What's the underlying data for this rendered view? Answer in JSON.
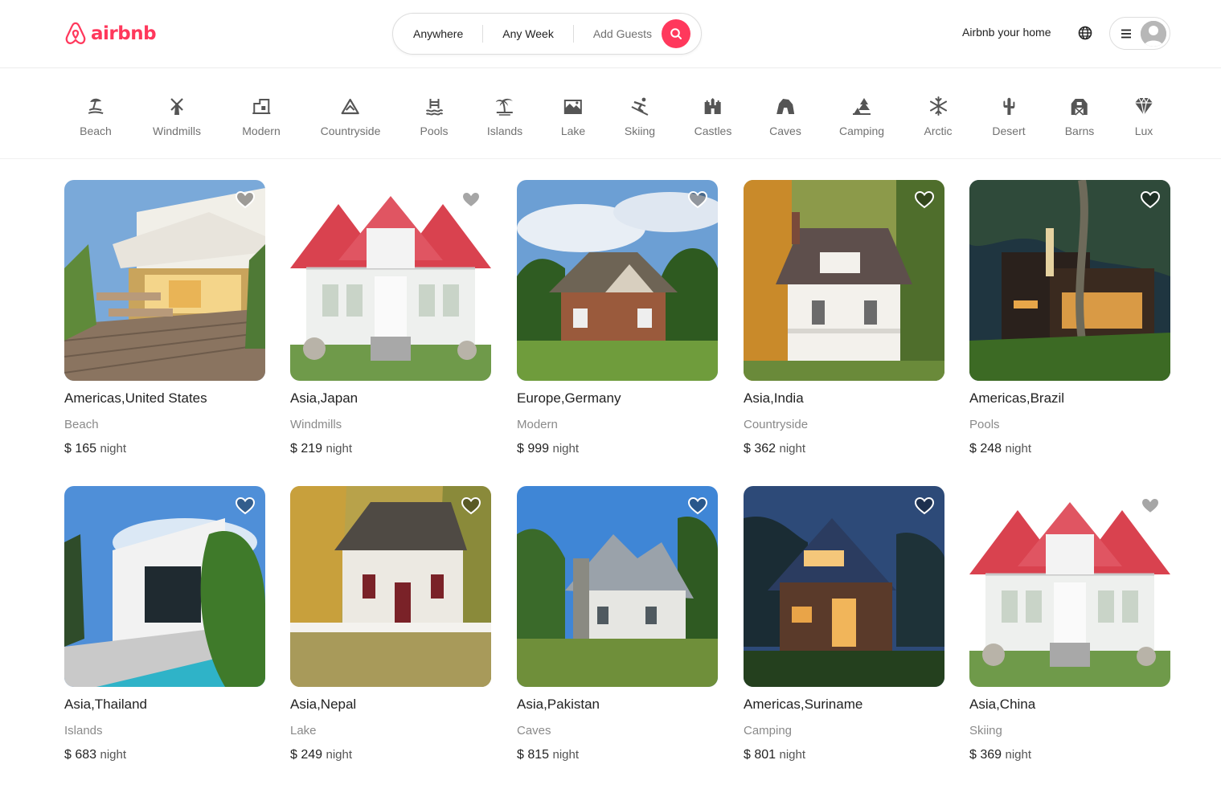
{
  "header": {
    "logo_text": "airbnb",
    "search": {
      "anywhere": "Anywhere",
      "any_week": "Any Week",
      "add_guests": "Add Guests"
    },
    "host_link": "Airbnb your home"
  },
  "brand_color": "#ff385c",
  "categories": [
    {
      "label": "Beach",
      "icon": "beach-icon"
    },
    {
      "label": "Windmills",
      "icon": "windmill-icon"
    },
    {
      "label": "Modern",
      "icon": "modern-house-icon"
    },
    {
      "label": "Countryside",
      "icon": "countryside-icon"
    },
    {
      "label": "Pools",
      "icon": "pool-icon"
    },
    {
      "label": "Islands",
      "icon": "island-icon"
    },
    {
      "label": "Lake",
      "icon": "lake-icon"
    },
    {
      "label": "Skiing",
      "icon": "skiing-icon"
    },
    {
      "label": "Castles",
      "icon": "castle-icon"
    },
    {
      "label": "Caves",
      "icon": "cave-icon"
    },
    {
      "label": "Camping",
      "icon": "camping-icon"
    },
    {
      "label": "Arctic",
      "icon": "snowflake-icon"
    },
    {
      "label": "Desert",
      "icon": "cactus-icon"
    },
    {
      "label": "Barns",
      "icon": "barn-icon"
    },
    {
      "label": "Lux",
      "icon": "diamond-icon"
    }
  ],
  "listings": [
    {
      "location": "Americas,United States",
      "type": "Beach",
      "price": "$ 165",
      "unit": "night"
    },
    {
      "location": "Asia,Japan",
      "type": "Windmills",
      "price": "$ 219",
      "unit": "night"
    },
    {
      "location": "Europe,Germany",
      "type": "Modern",
      "price": "$ 999",
      "unit": "night"
    },
    {
      "location": "Asia,India",
      "type": "Countryside",
      "price": "$ 362",
      "unit": "night"
    },
    {
      "location": "Americas,Brazil",
      "type": "Pools",
      "price": "$ 248",
      "unit": "night"
    },
    {
      "location": "Asia,Thailand",
      "type": "Islands",
      "price": "$ 683",
      "unit": "night"
    },
    {
      "location": "Asia,Nepal",
      "type": "Lake",
      "price": "$ 249",
      "unit": "night"
    },
    {
      "location": "Asia,Pakistan",
      "type": "Caves",
      "price": "$ 815",
      "unit": "night"
    },
    {
      "location": "Americas,Suriname",
      "type": "Camping",
      "price": "$ 801",
      "unit": "night"
    },
    {
      "location": "Asia,China",
      "type": "Skiing",
      "price": "$ 369",
      "unit": "night"
    }
  ]
}
